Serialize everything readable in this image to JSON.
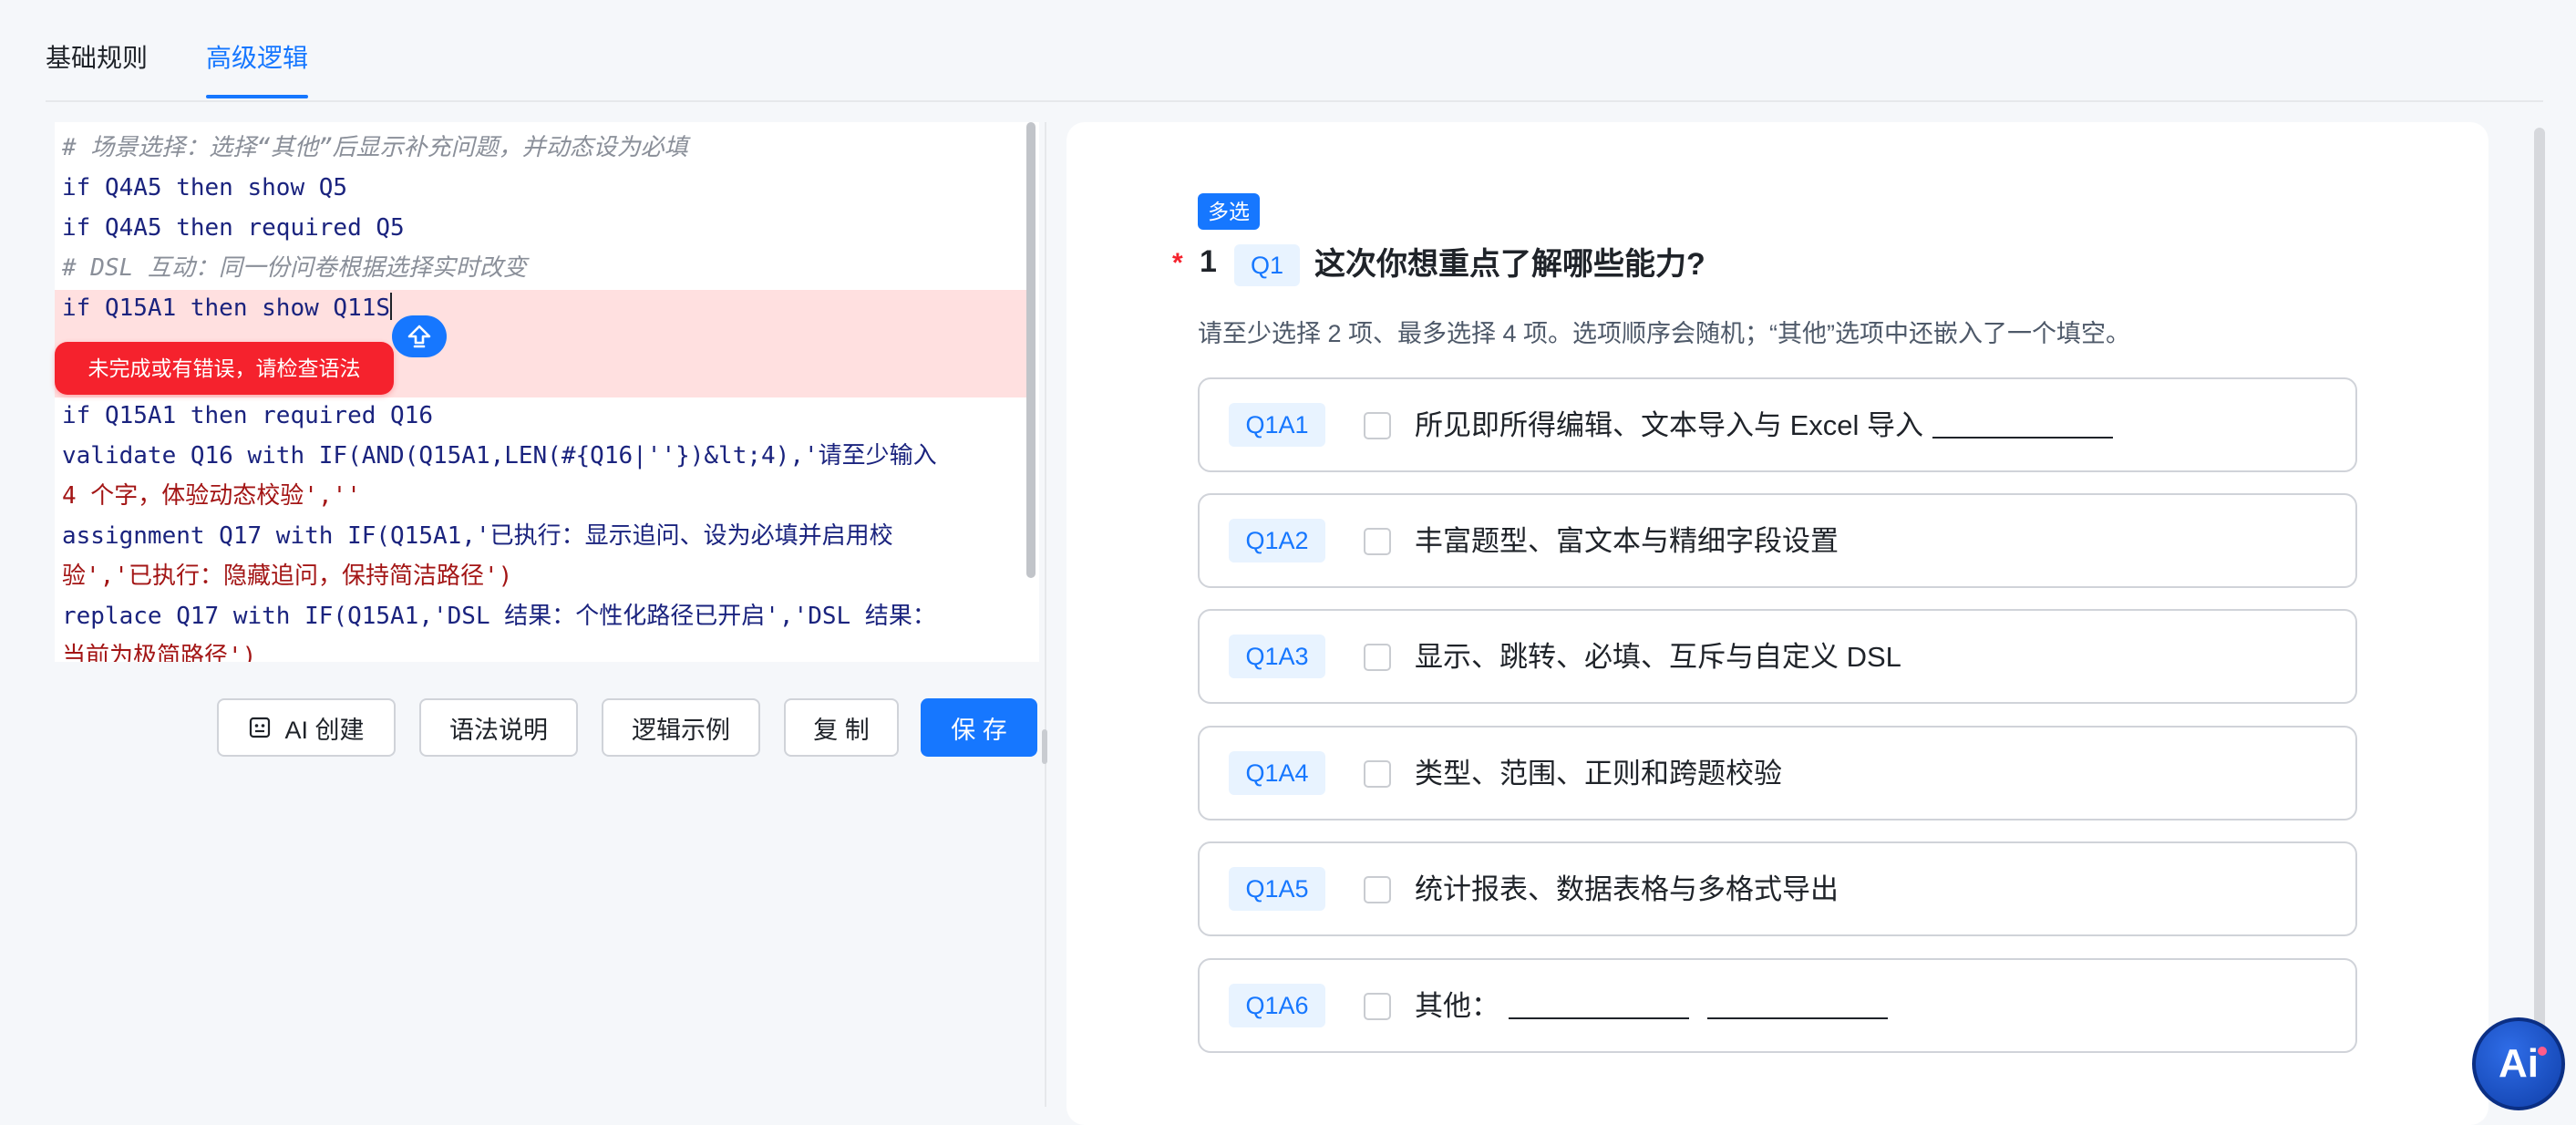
{
  "tabs": [
    {
      "label": "基础规则",
      "active": false
    },
    {
      "label": "高级逻辑",
      "active": true
    }
  ],
  "editor": {
    "lines": [
      "# 场景选择：选择“其他”后显示补充问题，并动态设为必填",
      "if Q4A5 then show Q5",
      "if Q4A5 then required Q5",
      "# DSL 互动：同一份问卷根据选择实时改变",
      "if Q15A1 then show Q11S",
      "if Q15A1 then required Q16",
      "validate Q16 with IF(AND(Q15A1,LEN(#{Q16|''})&lt;4),'请至少输入",
      "4 个字，体验动态校验',''",
      "assignment Q17 with IF(Q15A1,'已执行：显示追问、设为必填并启用校",
      "验','已执行：隐藏追问，保持简洁路径')",
      "replace Q17 with IF(Q15A1,'DSL 结果：个性化路径已开启','DSL 结果：",
      "当前为极简路径')"
    ],
    "error_message": "未完成或有错误，请检查语法"
  },
  "toolbar": {
    "ai_create": "AI 创建",
    "syntax_help": "语法说明",
    "logic_examples": "逻辑示例",
    "copy": "复 制",
    "save": "保 存"
  },
  "question": {
    "type_tag": "多选",
    "required_mark": "*",
    "number": "1",
    "code": "Q1",
    "title": "这次你想重点了解哪些能力?",
    "hint": "请至少选择 2 项、最多选择 4 项。选项顺序会随机；“其他”选项中还嵌入了一个填空。",
    "options": [
      {
        "code": "Q1A1",
        "label": "所见即所得编辑、文本导入与 Excel 导入"
      },
      {
        "code": "Q1A2",
        "label": "丰富题型、富文本与精细字段设置"
      },
      {
        "code": "Q1A3",
        "label": "显示、跳转、必填、互斥与自定义 DSL"
      },
      {
        "code": "Q1A4",
        "label": "类型、范围、正则和跨题校验"
      },
      {
        "code": "Q1A5",
        "label": "统计报表、数据表格与多格式导出"
      },
      {
        "code": "Q1A6",
        "label": "其他："
      }
    ]
  },
  "assistant": {
    "label": "Ai"
  },
  "colors": {
    "accent": "#1677ff",
    "error": "#f5222d",
    "error_band": "#ffe0e0"
  }
}
